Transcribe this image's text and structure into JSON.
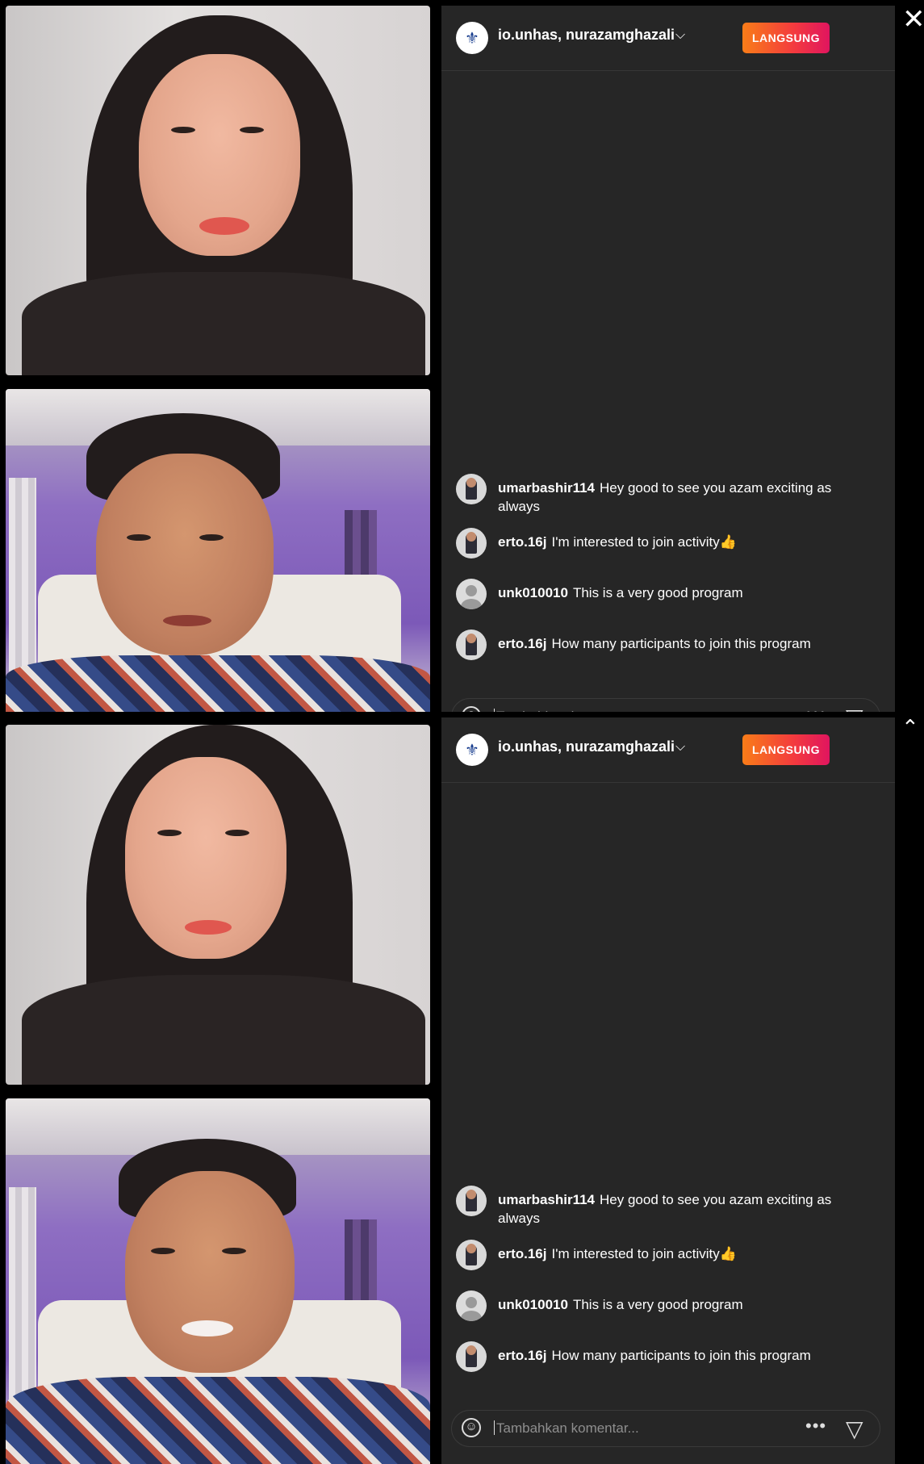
{
  "app": {
    "live_label": "LANGSUNG"
  },
  "header": {
    "hosts": "io.unhas, nurazamghazali",
    "chevron": "⌵"
  },
  "comments": [
    {
      "user": "umarbashir114",
      "text": "Hey good to see you azam exciting as always",
      "avatar": "person"
    },
    {
      "user": "erto.16j",
      "text": "I'm interested to join activity👍",
      "avatar": "person"
    },
    {
      "user": "unk010010",
      "text": "This is a very good program",
      "avatar": "generic"
    },
    {
      "user": "erto.16j",
      "text": "How many participants to join this program",
      "avatar": "person"
    }
  ],
  "input": {
    "placeholder": "Tambahkan komentar..."
  },
  "icons": {
    "close": "✕",
    "collapse": "⌃",
    "more": "•••",
    "send": "▽",
    "emoji": "☺"
  },
  "colors": {
    "panel_bg": "#262626",
    "live_gradient_start": "#f97d18",
    "live_gradient_end": "#e0155f"
  }
}
